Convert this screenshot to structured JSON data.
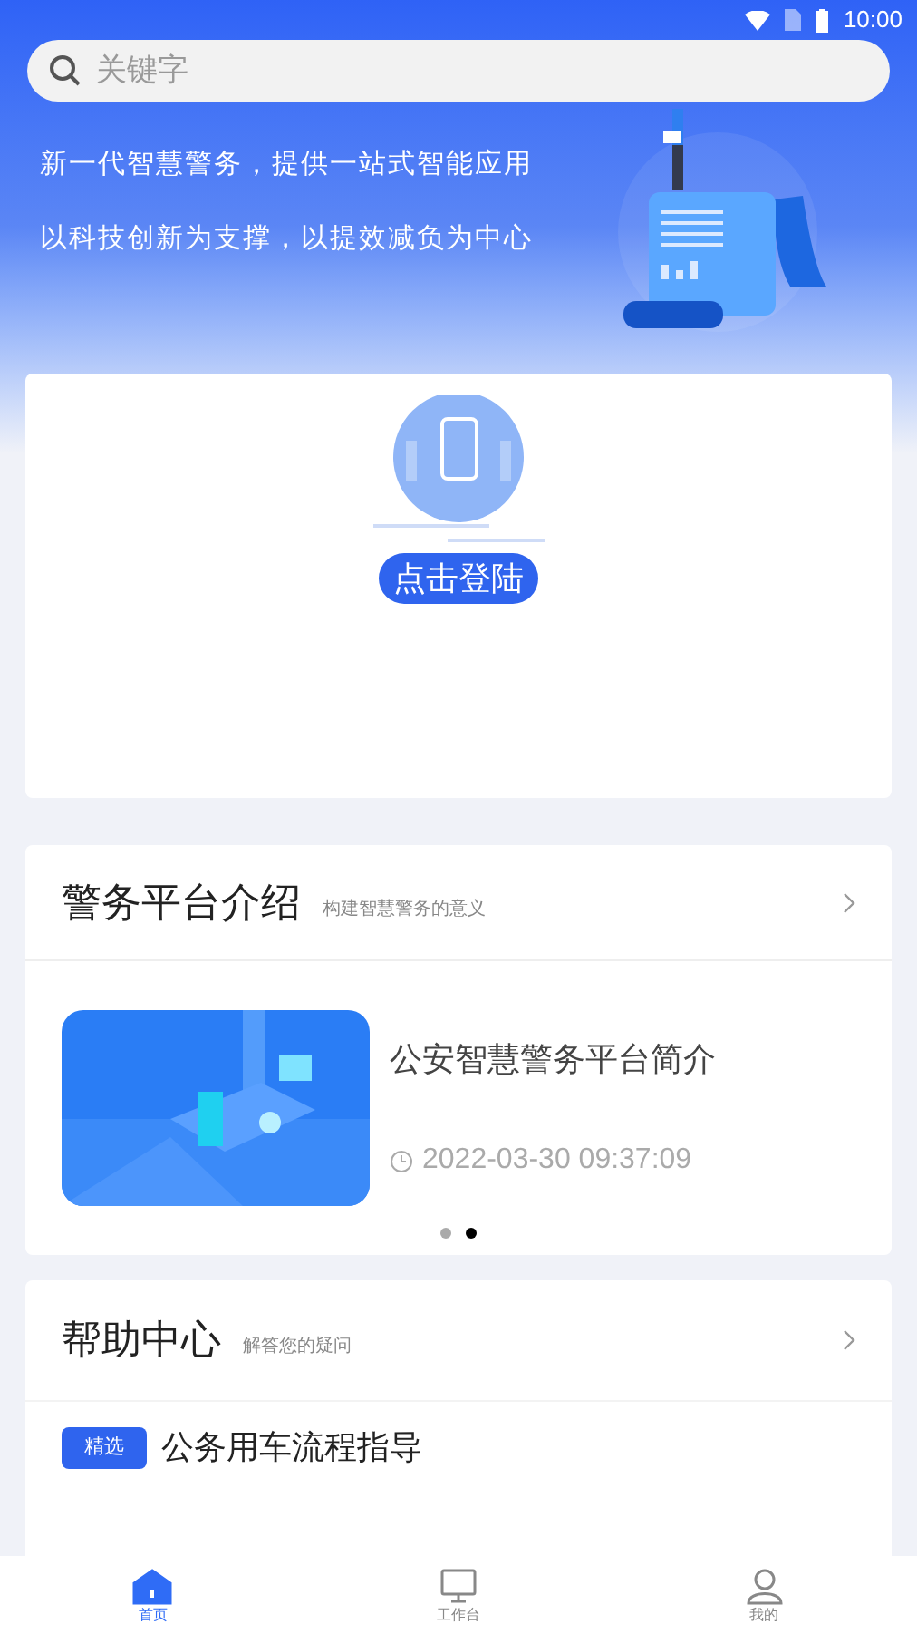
{
  "status_bar": {
    "time": "10:00"
  },
  "search": {
    "placeholder": "关键字"
  },
  "banner": {
    "lines": [
      "新一代智慧警务，提供一站式智能应用",
      "以科技创新为支撑，以提效减负为中心"
    ]
  },
  "login_card": {
    "button": "点击登陆"
  },
  "platform_section": {
    "title": "警务平台介绍",
    "subtitle": "构建智慧警务的意义",
    "article": {
      "kind": "picture",
      "title": "公安智慧警务平台简介",
      "time": "2022-03-30 09:37:09"
    },
    "dots": [
      {
        "selected": false
      },
      {
        "selected": true
      }
    ]
  },
  "help_section": {
    "title": "帮助中心",
    "subtitle": "解答您的疑问",
    "items": [
      {
        "tag": "精选",
        "title": "公务用车流程指导"
      }
    ]
  },
  "nav": [
    {
      "label": "首页",
      "kind": "home",
      "selected": true
    },
    {
      "label": "工作台",
      "kind": "desk",
      "selected": false
    },
    {
      "label": "我的",
      "kind": "user",
      "selected": false
    }
  ]
}
